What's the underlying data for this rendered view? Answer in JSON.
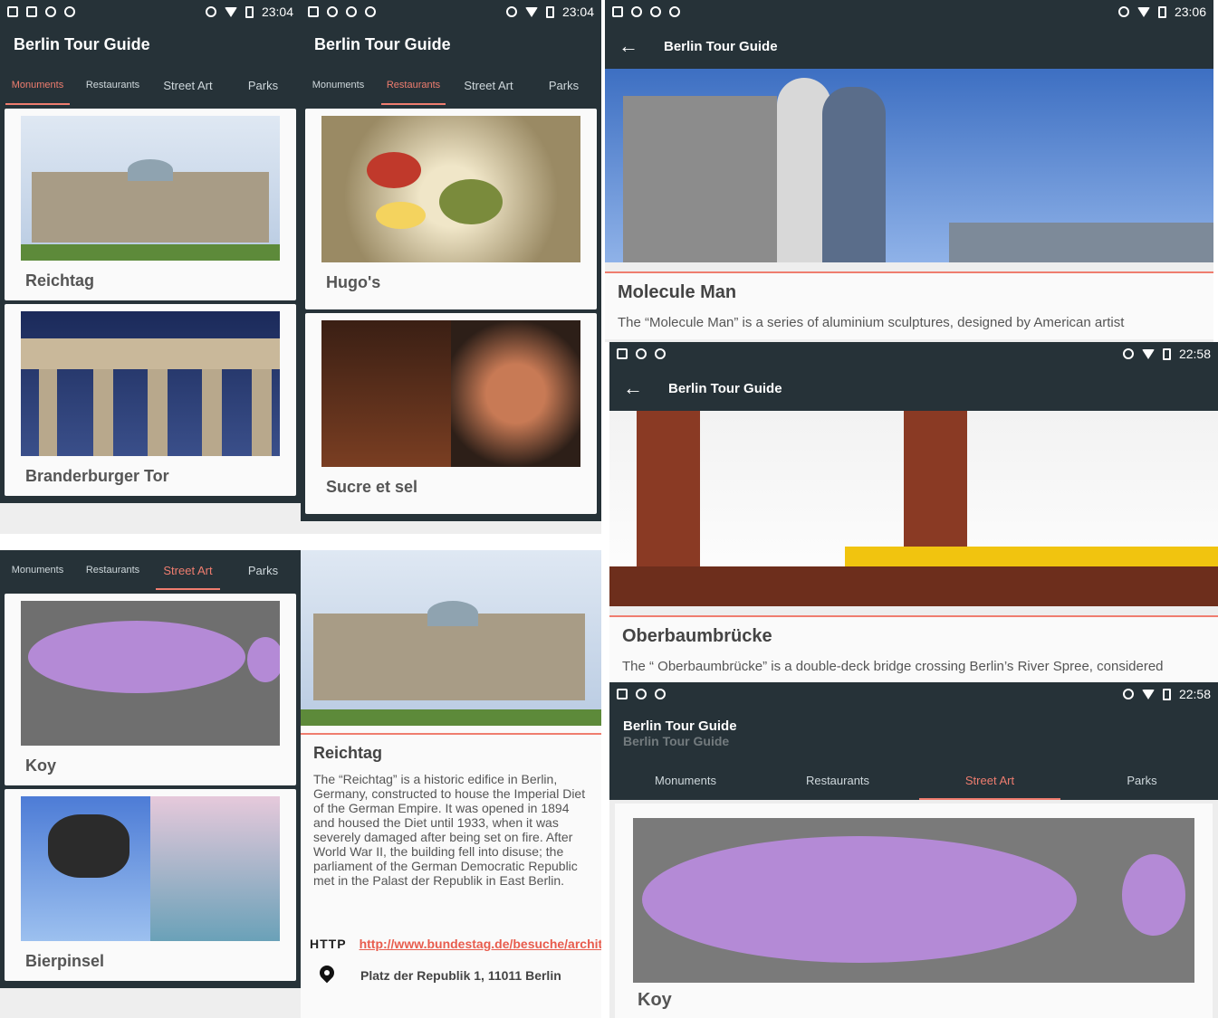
{
  "app": {
    "title": "Berlin Tour Guide"
  },
  "status": {
    "time_a": "23:04",
    "time_b": "23:04",
    "time_c": "23:06",
    "time_d": "22:58",
    "time_e": "22:58"
  },
  "tabs": [
    "Monuments",
    "Restaurants",
    "Street Art",
    "Parks"
  ],
  "monuments": {
    "cards": [
      "Reichtag",
      "Branderburger Tor"
    ]
  },
  "restaurants": {
    "cards": [
      "Hugo's",
      "Sucre et sel"
    ]
  },
  "street_art": {
    "cards": [
      "Koy",
      "Bierpinsel"
    ]
  },
  "reichtag_detail": {
    "title": "Reichtag",
    "text": "The “Reichtag” is a historic edifice in Berlin, Germany, constructed to house the Imperial Diet of the German Empire. It was opened in 1894 and housed the Diet until 1933, when it was severely damaged after being set on fire. After World War II, the building fell into disuse; the parliament of the German Democratic Republic met in the Palast der Republik in East Berlin.",
    "http_label": "HTTP",
    "link": "http://www.bundestag.de/besuche/architektur/reichstag/",
    "address": "Platz der Republik 1, 11011 Berlin"
  },
  "molecule_detail": {
    "title": "Molecule Man",
    "text": "The “Molecule Man” is a series of aluminium sculptures, designed by American artist"
  },
  "oberbaum_detail": {
    "title": "Oberbaumbrücke",
    "text": "The “ Oberbaumbrücke” is a double-deck bridge crossing Berlin’s River Spree, considered"
  },
  "transition": {
    "caption": "Koy",
    "ghost_title": "Berlin Tour Guide"
  },
  "colors": {
    "primary": "#263238",
    "accent": "#ef7d6f"
  }
}
